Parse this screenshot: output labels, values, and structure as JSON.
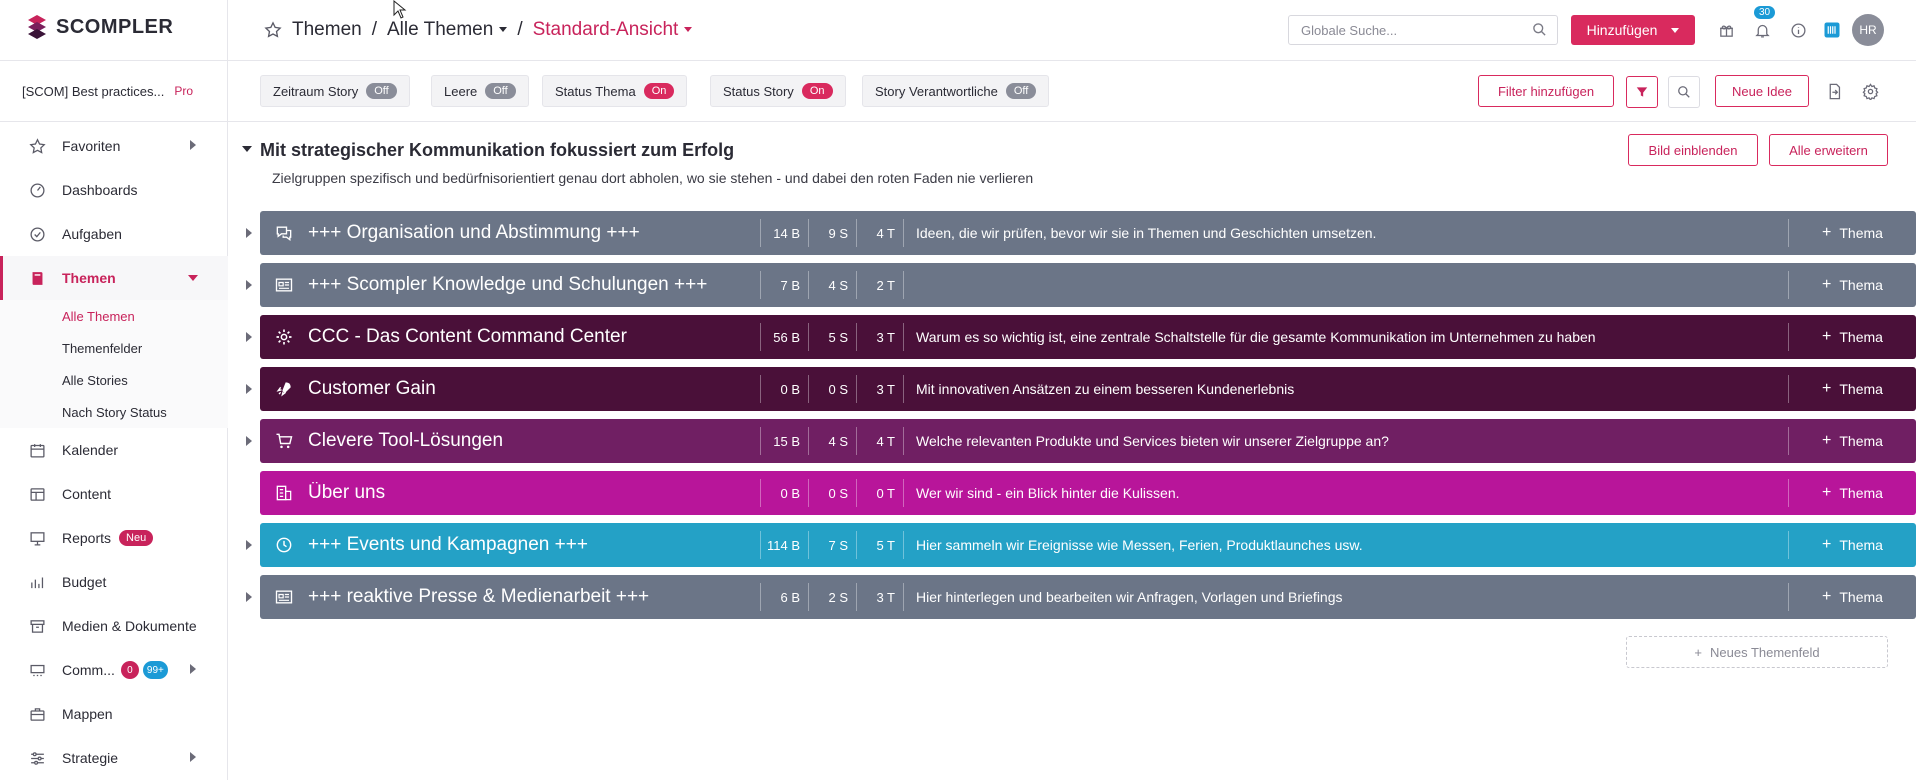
{
  "sidebar": {
    "logo_text": "SCOMPLER",
    "workspace_name": "[SCOM] Best practices...",
    "workspace_plan": "Pro",
    "items": [
      {
        "label": "Favoriten"
      },
      {
        "label": "Dashboards"
      },
      {
        "label": "Aufgaben"
      },
      {
        "label": "Themen"
      },
      {
        "label": "Kalender"
      },
      {
        "label": "Content"
      },
      {
        "label": "Reports",
        "badge": "Neu"
      },
      {
        "label": "Budget"
      },
      {
        "label": "Medien & Dokumente"
      },
      {
        "label": "Comm...",
        "badge_red": "0",
        "badge_blue": "99+"
      },
      {
        "label": "Mappen"
      },
      {
        "label": "Strategie"
      }
    ],
    "sub_items": [
      {
        "label": "Alle Themen"
      },
      {
        "label": "Themenfelder"
      },
      {
        "label": "Alle Stories"
      },
      {
        "label": "Nach Story Status"
      }
    ]
  },
  "topbar": {
    "crumb1": "Themen",
    "sep": "/",
    "crumb2": "Alle Themen",
    "crumb3": "Standard-Ansicht",
    "search_placeholder": "Globale Suche...",
    "add_label": "Hinzufügen",
    "notification_count": "30",
    "avatar_initials": "HR"
  },
  "filters": {
    "chips": [
      {
        "label": "Zeitraum Story",
        "state": "Off"
      },
      {
        "label": "Leere",
        "state": "Off"
      },
      {
        "label": "Status Thema",
        "state": "On"
      },
      {
        "label": "Status Story",
        "state": "On"
      },
      {
        "label": "Story Verantwortliche",
        "state": "Off"
      }
    ],
    "add_filter_label": "Filter hinzufügen",
    "new_idea_label": "Neue Idee"
  },
  "section": {
    "title": "Mit strategischer Kommunikation fokussiert zum Erfolg",
    "subtitle": "Zielgruppen spezifisch und bedürfnisorientiert genau dort abholen, wo sie stehen - und dabei den roten Faden nie verlieren",
    "show_image_label": "Bild einblenden",
    "expand_all_label": "Alle erweitern"
  },
  "rows": [
    {
      "name": "+++ Organisation und Abstimmung +++",
      "b": "14 B",
      "s": "9 S",
      "t": "4 T",
      "desc": "Ideen, die wir prüfen, bevor wir sie in Themen und Geschichten umsetzen.",
      "color": "#6b7587",
      "icon": "chat-icon",
      "glyph": "💬",
      "thema": "Thema"
    },
    {
      "name": "+++ Scompler Knowledge und Schulungen +++",
      "b": "7 B",
      "s": "4 S",
      "t": "2 T",
      "desc": "",
      "color": "#6b7587",
      "icon": "newspaper-icon",
      "glyph": "📰",
      "thema": "Thema"
    },
    {
      "name": "CCC - Das Content Command Center",
      "b": "56 B",
      "s": "5 S",
      "t": "3 T",
      "desc": "Warum es so wichtig ist, eine zentrale Schaltstelle für die gesamte Kommunikation im Unternehmen zu haben",
      "color": "#4a1039",
      "icon": "gear-icon",
      "glyph": "⚙",
      "thema": "Thema"
    },
    {
      "name": "Customer Gain",
      "b": "0 B",
      "s": "0 S",
      "t": "3 T",
      "desc": "Mit innovativen Ansätzen zu einem besseren Kundenerlebnis",
      "color": "#4a1039",
      "icon": "rocket-icon",
      "glyph": "🚀",
      "thema": "Thema"
    },
    {
      "name": "Clevere Tool-Lösungen",
      "b": "15 B",
      "s": "4 S",
      "t": "4 T",
      "desc": "Welche relevanten Produkte und Services bieten wir unserer Zielgruppe an?",
      "color": "#701f63",
      "icon": "cart-icon",
      "glyph": "🛒",
      "thema": "Thema"
    },
    {
      "name": "Über uns",
      "b": "0 B",
      "s": "0 S",
      "t": "0 T",
      "desc": "Wer wir sind - ein Blick hinter die Kulissen.",
      "color": "#b8159a",
      "icon": "building-icon",
      "glyph": "🏢",
      "thema": "Thema"
    },
    {
      "name": "+++ Events und Kampagnen +++",
      "b": "114 B",
      "s": "7 S",
      "t": "5 T",
      "desc": "Hier sammeln wir Ereignisse wie Messen, Ferien, Produktlaunches usw.",
      "color": "#24a1c6",
      "icon": "clock-icon",
      "glyph": "🕒",
      "thema": "Thema"
    },
    {
      "name": "+++ reaktive Presse & Medienarbeit +++",
      "b": "6 B",
      "s": "2 S",
      "t": "3 T",
      "desc": "Hier hinterlegen und bearbeiten wir Anfragen, Vorlagen und Briefings",
      "color": "#6b7587",
      "icon": "newspaper-icon",
      "glyph": "📰",
      "thema": "Thema"
    }
  ],
  "new_field_label": "Neues Themenfeld"
}
